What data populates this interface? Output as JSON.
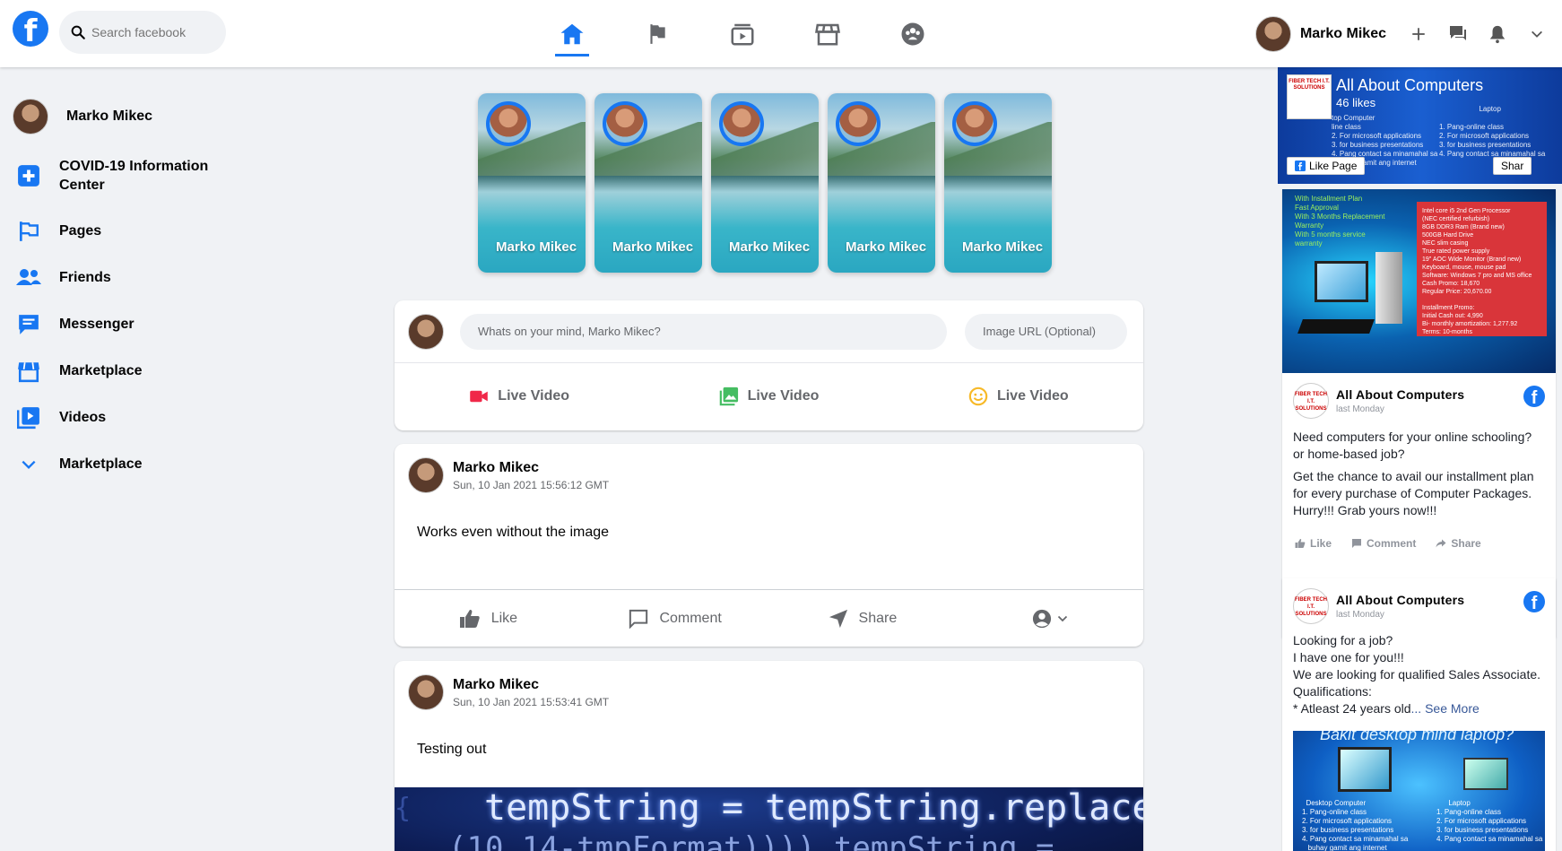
{
  "header": {
    "search_placeholder": "Search facebook",
    "user_name": "Marko Mikec",
    "nav": [
      "home-icon",
      "flag-icon",
      "watch-icon",
      "marketplace-icon",
      "groups-icon"
    ],
    "accent": "#1877f2"
  },
  "sidebar": {
    "profile_name": "Marko Mikec",
    "items": [
      {
        "label": "COVID-19 Information Center",
        "icon": "plus-square-icon"
      },
      {
        "label": "Pages",
        "icon": "flag-icon"
      },
      {
        "label": "Friends",
        "icon": "friends-icon"
      },
      {
        "label": "Messenger",
        "icon": "messenger-icon"
      },
      {
        "label": "Marketplace",
        "icon": "marketplace-icon"
      },
      {
        "label": "Videos",
        "icon": "video-icon"
      },
      {
        "label": "Marketplace",
        "icon": "chevron-down-icon"
      }
    ]
  },
  "stories": [
    {
      "name": "Marko Mikec"
    },
    {
      "name": "Marko Mikec"
    },
    {
      "name": "Marko Mikec"
    },
    {
      "name": "Marko Mikec"
    },
    {
      "name": "Marko Mikec"
    }
  ],
  "composer": {
    "placeholder": "Whats on your mind, Marko Mikec?",
    "url_placeholder": "Image URL (Optional)",
    "buttons": [
      "Live Video",
      "Live Video",
      "Live Video"
    ]
  },
  "posts": [
    {
      "author": "Marko Mikec",
      "time": "Sun, 10 Jan 2021 15:56:12 GMT",
      "text": "Works even without the image"
    },
    {
      "author": "Marko Mikec",
      "time": "Sun, 10 Jan 2021 15:53:41 GMT",
      "text": "Testing out"
    }
  ],
  "post_actions": {
    "like": "Like",
    "comment": "Comment",
    "share": "Share"
  },
  "code_image": {
    "line1": "tempString = tempString.replace(",
    "line2": "(10,14-tmpFormat)))) tempString ="
  },
  "ads": {
    "banner": {
      "title": "All About Computers",
      "likes": "46 likes",
      "like_page": "Like Page",
      "share": "Shar",
      "logo_text": "FIBER TECH I.T. SOLUTIONS"
    },
    "ad1": {
      "name": "All About Computers",
      "time": "last Monday",
      "p1": "Need computers for your online schooling? or home-based job?",
      "p2": "Get the chance to avail our installment plan for every purchase of Computer Packages. Hurry!!! Grab yours now!!!",
      "like": "Like",
      "comment": "Comment",
      "share": "Share",
      "logo_text": "FIBER TECH I.T. SOLUTIONS"
    },
    "ad2": {
      "name": "All About Computers",
      "time": "last Monday",
      "lines": [
        "Looking for a job?",
        "I have one for you!!!",
        "We are looking for qualified Sales Associate.",
        "Qualifications:"
      ],
      "last_line": "* Atleast 24 years old",
      "see_more": "... See More",
      "img_title": "Bakit desktop mind laptop?",
      "logo_text": "FIBER TECH I.T. SOLUTIONS"
    }
  }
}
